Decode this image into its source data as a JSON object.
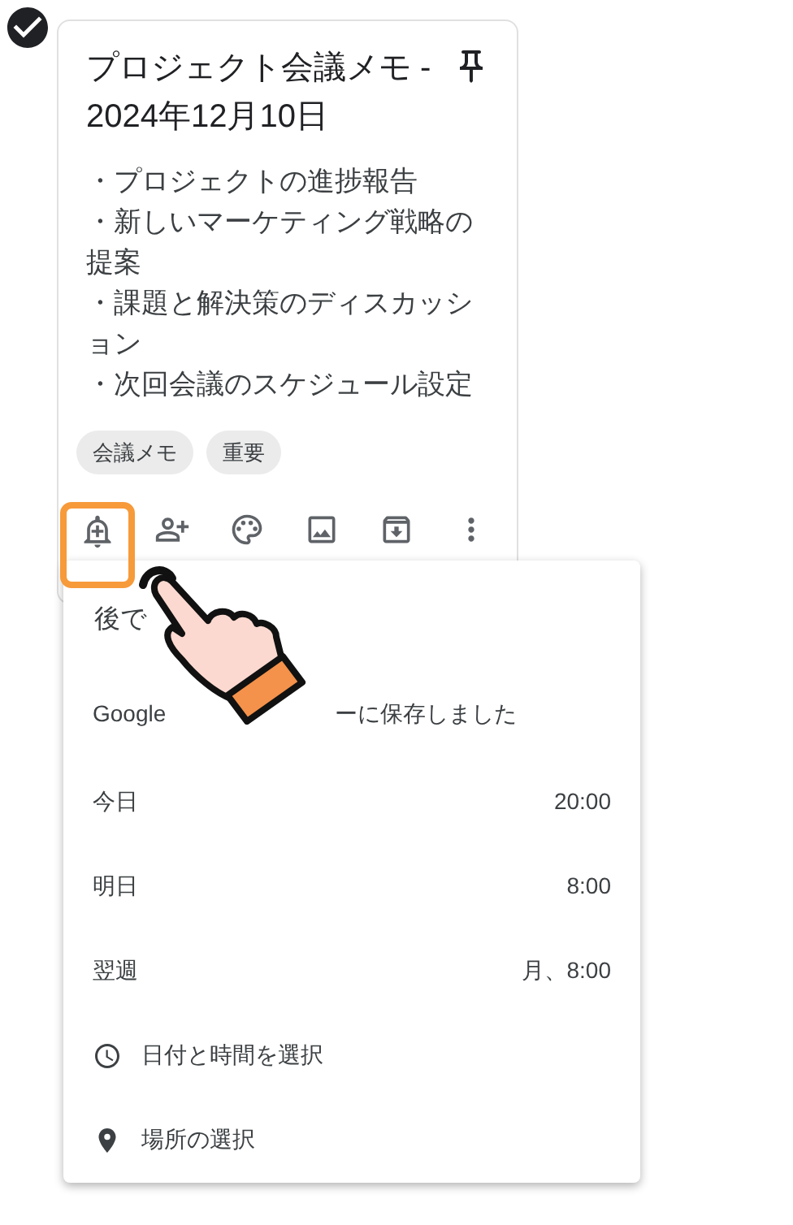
{
  "note": {
    "selected": true,
    "title": "プロジェクト会議メモ - 2024年12月10日",
    "body": [
      "・プロジェクトの進捗報告",
      "・新しいマーケティング戦略の提案",
      "・課題と解決策のディスカッション",
      "・次回会議のスケジュール設定"
    ],
    "labels": [
      "会議メモ",
      "重要"
    ]
  },
  "reminder_menu": {
    "header": "後で",
    "saved_info": [
      "Google",
      "ーに保存しました"
    ],
    "items": [
      {
        "kind": "preset",
        "label": "今日",
        "time": "20:00"
      },
      {
        "kind": "preset",
        "label": "明日",
        "time": "8:00"
      },
      {
        "kind": "preset",
        "label": "翌週",
        "time": "月、8:00"
      },
      {
        "kind": "datetime",
        "label": "日付と時間を選択"
      },
      {
        "kind": "place",
        "label": "場所の選択"
      }
    ]
  }
}
